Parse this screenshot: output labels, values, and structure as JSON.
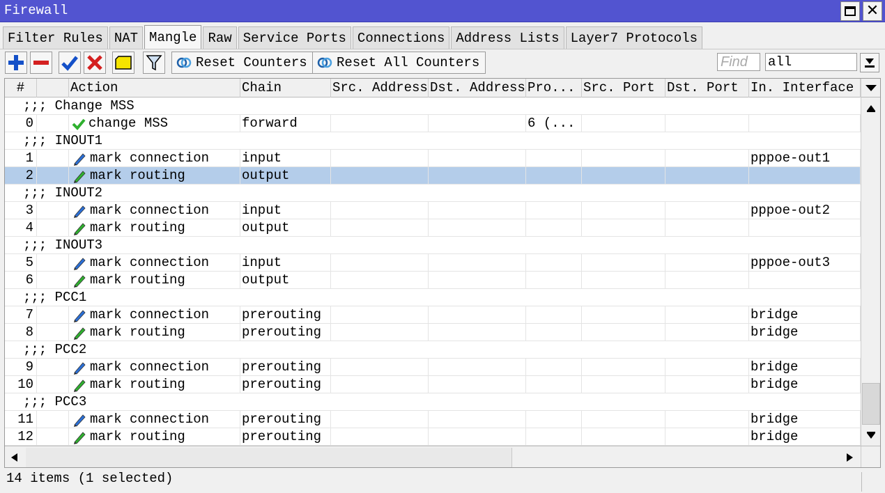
{
  "window": {
    "title": "Firewall"
  },
  "tabs": [
    "Filter Rules",
    "NAT",
    "Mangle",
    "Raw",
    "Service Ports",
    "Connections",
    "Address Lists",
    "Layer7 Protocols"
  ],
  "active_tab": "Mangle",
  "toolbar": {
    "add_icon": "plus-icon",
    "remove_icon": "minus-icon",
    "enable_icon": "check-icon",
    "disable_icon": "x-icon",
    "comment_icon": "note-icon",
    "filter_icon": "filter-icon",
    "reset_counters": "Reset Counters",
    "reset_all_counters": "Reset All Counters",
    "find_placeholder": "Find",
    "filter_value": "all"
  },
  "columns": [
    "#",
    "",
    "Action",
    "Chain",
    "Src. Address",
    "Dst. Address",
    "Pro...",
    "Src. Port",
    "Dst. Port",
    "In. Interface"
  ],
  "rows": [
    {
      "type": "comment",
      "text": ";;; Change MSS"
    },
    {
      "type": "rule",
      "num": "0",
      "icon": "check",
      "action": "change MSS",
      "chain": "forward",
      "proto": "6 (...",
      "in_iface": ""
    },
    {
      "type": "comment",
      "text": ";;; INOUT1"
    },
    {
      "type": "rule",
      "num": "1",
      "icon": "pen-blue",
      "action": "mark connection",
      "chain": "input",
      "proto": "",
      "in_iface": "pppoe-out1"
    },
    {
      "type": "rule",
      "num": "2",
      "icon": "pen-green",
      "action": "mark routing",
      "chain": "output",
      "proto": "",
      "in_iface": "",
      "selected": true
    },
    {
      "type": "comment",
      "text": ";;; INOUT2"
    },
    {
      "type": "rule",
      "num": "3",
      "icon": "pen-blue",
      "action": "mark connection",
      "chain": "input",
      "proto": "",
      "in_iface": "pppoe-out2"
    },
    {
      "type": "rule",
      "num": "4",
      "icon": "pen-green",
      "action": "mark routing",
      "chain": "output",
      "proto": "",
      "in_iface": ""
    },
    {
      "type": "comment",
      "text": ";;; INOUT3"
    },
    {
      "type": "rule",
      "num": "5",
      "icon": "pen-blue",
      "action": "mark connection",
      "chain": "input",
      "proto": "",
      "in_iface": "pppoe-out3"
    },
    {
      "type": "rule",
      "num": "6",
      "icon": "pen-green",
      "action": "mark routing",
      "chain": "output",
      "proto": "",
      "in_iface": ""
    },
    {
      "type": "comment",
      "text": ";;; PCC1"
    },
    {
      "type": "rule",
      "num": "7",
      "icon": "pen-blue",
      "action": "mark connection",
      "chain": "prerouting",
      "proto": "",
      "in_iface": "bridge"
    },
    {
      "type": "rule",
      "num": "8",
      "icon": "pen-green",
      "action": "mark routing",
      "chain": "prerouting",
      "proto": "",
      "in_iface": "bridge"
    },
    {
      "type": "comment",
      "text": ";;; PCC2"
    },
    {
      "type": "rule",
      "num": "9",
      "icon": "pen-blue",
      "action": "mark connection",
      "chain": "prerouting",
      "proto": "",
      "in_iface": "bridge"
    },
    {
      "type": "rule",
      "num": "10",
      "icon": "pen-green",
      "action": "mark routing",
      "chain": "prerouting",
      "proto": "",
      "in_iface": "bridge"
    },
    {
      "type": "comment",
      "text": ";;; PCC3"
    },
    {
      "type": "rule",
      "num": "11",
      "icon": "pen-blue",
      "action": "mark connection",
      "chain": "prerouting",
      "proto": "",
      "in_iface": "bridge"
    },
    {
      "type": "rule",
      "num": "12",
      "icon": "pen-green",
      "action": "mark routing",
      "chain": "prerouting",
      "proto": "",
      "in_iface": "bridge"
    }
  ],
  "status": {
    "text": "14 items (1 selected)"
  },
  "colors": {
    "titlebar": "#5254d0",
    "selected_row": "#b4cdea",
    "pen_blue": "#2b6fd6",
    "pen_green": "#2fb02f"
  }
}
